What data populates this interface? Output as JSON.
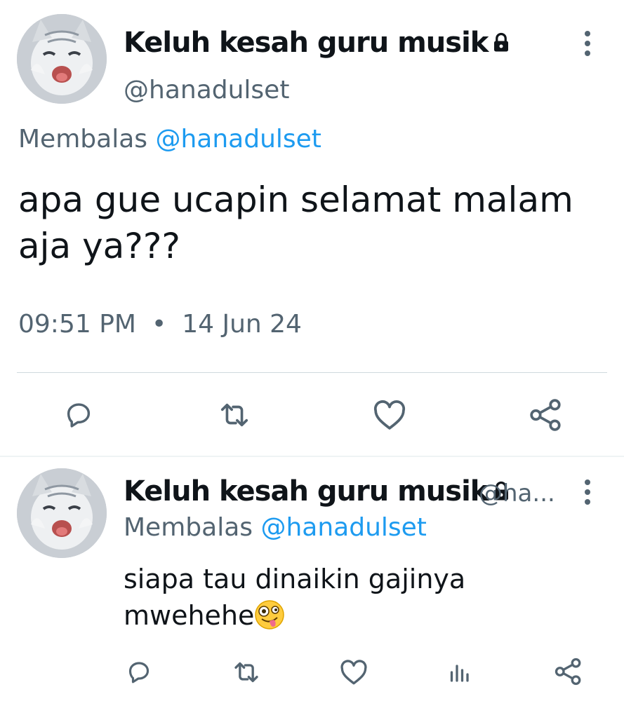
{
  "main_tweet": {
    "author_name": "Keluh kesah guru musik",
    "author_handle": "@hanadulset",
    "replying_prefix": "Membalas",
    "replying_to": "@hanadulset",
    "text_line1": "apa gue ucapin selamat malam",
    "text_line2": "aja ya???",
    "time": "09:51 PM",
    "separator": "•",
    "date": "14 Jun 24",
    "icons": [
      "lock-icon",
      "more-options-icon",
      "reply-icon",
      "retweet-icon",
      "like-icon",
      "share-icon"
    ]
  },
  "reply_tweet": {
    "author_name": "Keluh kesah guru musik",
    "author_handle": "@ha...",
    "replying_prefix": "Membalas",
    "replying_to": "@hanadulset",
    "text_line1": "siapa tau dinaikin gajinya",
    "text_line2": "mwehehe",
    "icons": [
      "lock-icon",
      "more-options-icon",
      "zany-face-emoji",
      "reply-icon",
      "retweet-icon",
      "like-icon",
      "views-icon",
      "share-icon"
    ]
  },
  "colors": {
    "text": "#0f1419",
    "secondary": "#536471",
    "link": "#1d9bf0",
    "divider": "#cfd9de"
  }
}
